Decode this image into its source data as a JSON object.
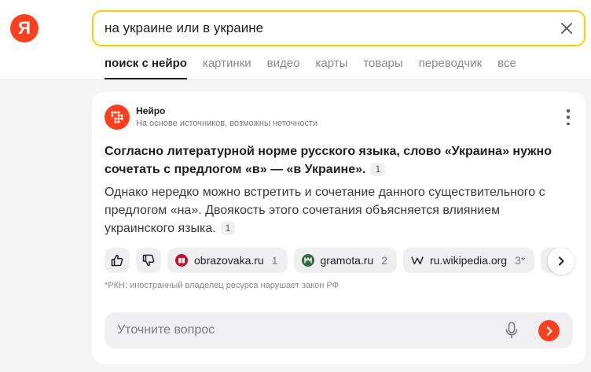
{
  "header": {
    "logo_letter": "Я",
    "search_query": "на украине или в украине"
  },
  "tabs": [
    {
      "label": "поиск с нейро",
      "active": true
    },
    {
      "label": "картинки"
    },
    {
      "label": "видео"
    },
    {
      "label": "карты"
    },
    {
      "label": "товары"
    },
    {
      "label": "переводчик"
    },
    {
      "label": "все"
    }
  ],
  "answer": {
    "source_name": "Нейро",
    "source_subtitle": "На основе источников, возможны неточности",
    "bold_text": "Согласно литературной норме русского языка, слово «Украина» нужно сочетать с предлогом «в» — «в Украине».",
    "bold_ref": "1",
    "body_text": "Однако нередко можно встретить и сочетание данного существительного с предлогом «на». Двоякость этого сочетания объясняется влиянием украинского языка.",
    "body_ref": "1"
  },
  "sources": [
    {
      "domain": "obrazovaka.ru",
      "count": "1",
      "icon": "book-icon"
    },
    {
      "domain": "gramota.ru",
      "count": "2",
      "icon": "gramota-icon"
    },
    {
      "domain": "ru.wikipedia.org",
      "count": "3*",
      "icon": "wikipedia-icon"
    }
  ],
  "rkn_note": "*РКН: иностранный владелец ресурса нарушает закон РФ",
  "followup": {
    "placeholder": "Уточните вопрос"
  },
  "colors": {
    "brand_red": "#fc3f1d",
    "search_border": "#ffcc00"
  }
}
